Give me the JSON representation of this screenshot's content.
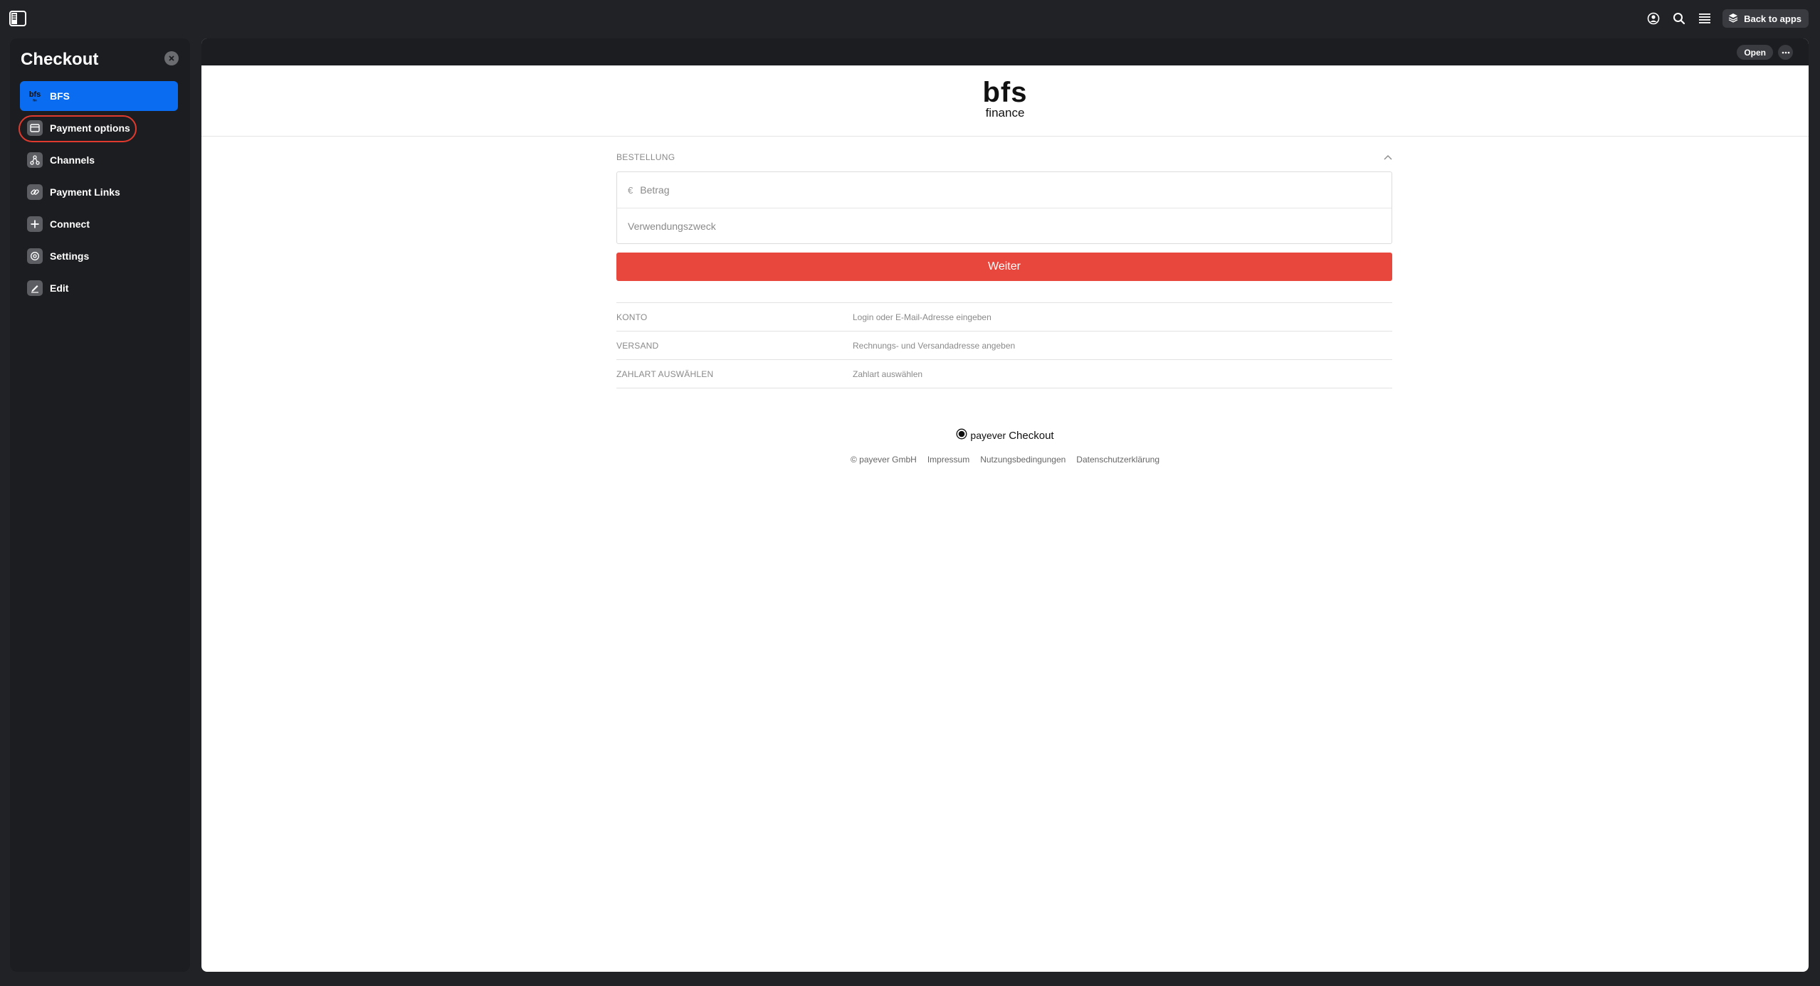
{
  "topbar": {
    "back_label": "Back to apps"
  },
  "sidebar": {
    "title": "Checkout",
    "items": [
      {
        "label": "BFS",
        "active": true
      },
      {
        "label": "Payment options"
      },
      {
        "label": "Channels"
      },
      {
        "label": "Payment Links"
      },
      {
        "label": "Connect"
      },
      {
        "label": "Settings"
      },
      {
        "label": "Edit"
      }
    ]
  },
  "main": {
    "open_label": "Open",
    "brand": {
      "line1": "bfs",
      "line2": "finance"
    },
    "order": {
      "section_label": "BESTELLUNG",
      "currency_symbol": "€",
      "amount_placeholder": "Betrag",
      "purpose_placeholder": "Verwendungszweck",
      "continue_label": "Weiter"
    },
    "steps": [
      {
        "label": "KONTO",
        "value": "Login oder E-Mail-Adresse eingeben"
      },
      {
        "label": "VERSAND",
        "value": "Rechnungs- und Versandadresse angeben"
      },
      {
        "label": "ZAHLART AUSWÄHLEN",
        "value": "Zahlart auswählen"
      }
    ],
    "footer": {
      "brand": "payever",
      "product": "Checkout",
      "copyright": "© payever GmbH",
      "links": [
        "Impressum",
        "Nutzungsbedingungen",
        "Datenschutzerklärung"
      ]
    }
  },
  "colors": {
    "accent_blue": "#0a6cf0",
    "button_red": "#e8473e",
    "highlight_red": "#e03a2e",
    "background": "#212226"
  }
}
